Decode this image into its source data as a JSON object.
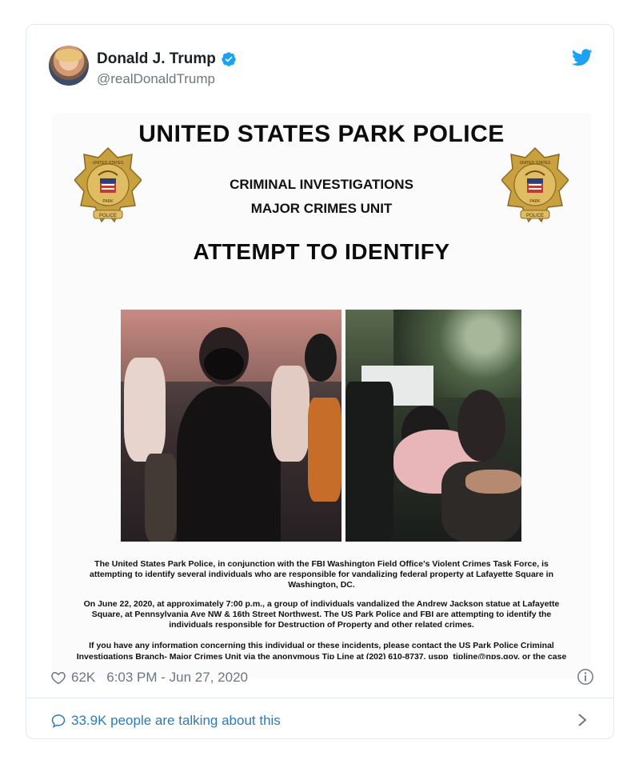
{
  "tweet": {
    "display_name": "Donald J. Trump",
    "handle": "@realDonaldTrump",
    "likes": "62K",
    "timestamp": "6:03 PM - Jun 27, 2020",
    "talking": "33.9K people are talking about this"
  },
  "poster": {
    "title": "UNITED STATES PARK POLICE",
    "subtitle_1": "CRIMINAL INVESTIGATIONS",
    "subtitle_2": "MAJOR CRIMES UNIT",
    "heading": "ATTEMPT TO IDENTIFY",
    "paragraph_1": "The United States Park Police, in conjunction with the FBI Washington Field Office's Violent Crimes Task Force, is attempting to identify several individuals who are responsible for vandalizing federal property at Lafayette Square in Washington, DC.",
    "paragraph_2": "On June 22, 2020, at approximately 7:00 p.m., a group of individuals vandalized the Andrew Jackson statue at Lafayette Square, at Pennsylvania Ave NW & 16th Street Northwest.  The US Park Police and FBI are attempting to identify the individuals responsible for Destruction of Property and other related crimes.",
    "paragraph_3": "If you have any information concerning this individual or these incidents, please contact the US Park Police Criminal",
    "paragraph_4": "Investigations Branch- Major Crimes Unit via the anonymous Tip Line at (202) 610-8737, uspp_tipline@nps.gov, or the case",
    "badge_text_top": "UNITED STATES",
    "badge_text_mid": "PARK",
    "badge_text_bottom": "POLICE"
  },
  "icons": {
    "verified": "verified-badge-icon",
    "bird": "twitter-bird-icon",
    "heart": "heart-icon",
    "info": "info-icon",
    "bubble": "speech-bubble-icon",
    "chevron": "chevron-right-icon"
  },
  "colors": {
    "twitter_blue": "#1da1f2",
    "link_blue": "#2b7bb9",
    "gray_text": "#697882",
    "badge_gold": "#c9a040"
  }
}
